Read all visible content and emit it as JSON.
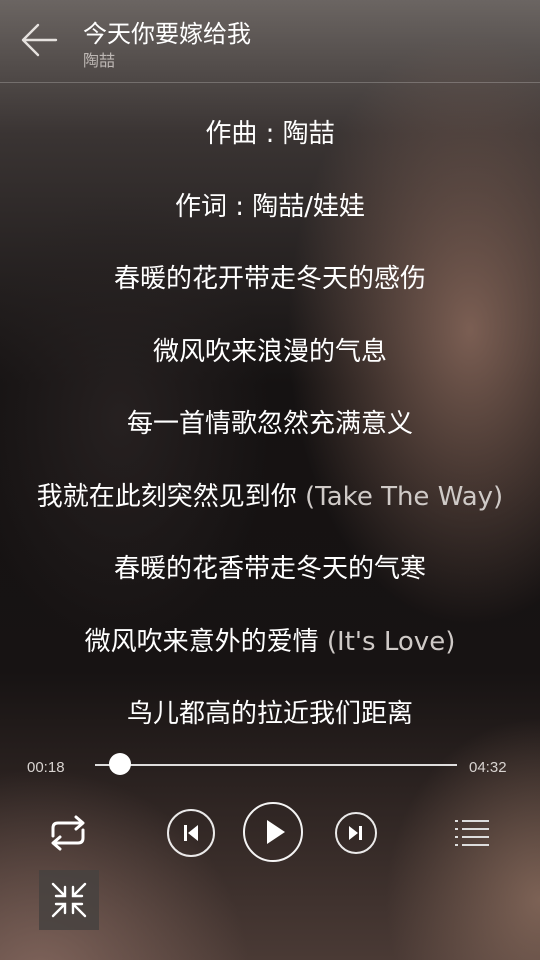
{
  "header": {
    "song_title": "今天你要嫁给我",
    "artist": "陶喆",
    "back_icon": "arrow-left-icon"
  },
  "lyrics": [
    {
      "text": "作曲 : 陶喆",
      "translation": ""
    },
    {
      "text": "作词 : 陶喆/娃娃",
      "translation": ""
    },
    {
      "text": "春暖的花开带走冬天的感伤",
      "translation": ""
    },
    {
      "text": "微风吹来浪漫的气息",
      "translation": ""
    },
    {
      "text": "每一首情歌忽然充满意义",
      "translation": ""
    },
    {
      "text": "我就在此刻突然见到你 ",
      "translation": "(Take The Way)"
    },
    {
      "text": "春暖的花香带走冬天的气寒",
      "translation": ""
    },
    {
      "text": "微风吹来意外的爱情 ",
      "translation": "(It's Love)"
    },
    {
      "text": "鸟儿都高的拉近我们距离",
      "translation": ""
    }
  ],
  "player": {
    "current_time": "00:18",
    "total_time": "04:32",
    "progress_fraction": 0.07,
    "controls": [
      "repeat-icon",
      "previous-icon",
      "play-icon",
      "next-icon",
      "playlist-icon",
      "collapse-icon"
    ]
  }
}
